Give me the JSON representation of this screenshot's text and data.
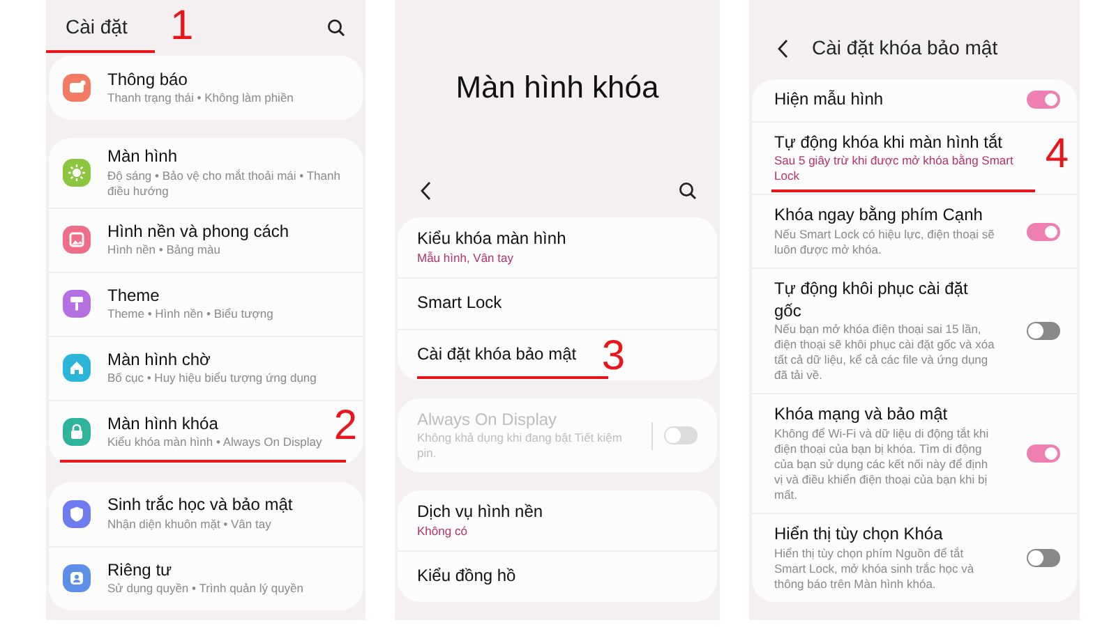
{
  "settings_screen": {
    "title": "Cài đặt",
    "title_marker": "1",
    "groups": [
      [
        {
          "title": "Thông báo",
          "subtitle": "Thanh trạng thái • Không làm phiền",
          "color": "#f37b64"
        }
      ],
      [
        {
          "title": "Màn hình",
          "subtitle": "Độ sáng • Bảo vệ cho mắt thoải mái • Thanh điều hướng",
          "color": "#8cc63f"
        },
        {
          "title": "Hình nền và phong cách",
          "subtitle": "Hình nền • Bảng màu",
          "color": "#ee6e8a"
        },
        {
          "title": "Theme",
          "subtitle": "Theme • Hình nền • Biểu tượng",
          "color": "#b56fe0"
        },
        {
          "title": "Màn hình chờ",
          "subtitle": "Bố cục • Huy hiệu biểu tượng ứng dụng",
          "color": "#2bb5d8"
        },
        {
          "title": "Màn hình khóa",
          "subtitle": "Kiểu khóa màn hình • Always On Display",
          "color": "#2fb39a",
          "marker": "2"
        }
      ],
      [
        {
          "title": "Sinh trắc học và bảo mật",
          "subtitle": "Nhận diện khuôn mặt • Vân tay",
          "color": "#6e7cf0"
        },
        {
          "title": "Riêng tư",
          "subtitle": "Sử dụng quyền • Trình quản lý quyền",
          "color": "#5d8fe8"
        }
      ]
    ]
  },
  "lock_screen": {
    "title": "Màn hình khóa",
    "groups": [
      [
        {
          "title": "Kiểu khóa màn hình",
          "subtitle": "Mẫu hình, Vân tay",
          "accent": true
        },
        {
          "title": "Smart Lock"
        },
        {
          "title": "Cài đặt khóa bảo mật",
          "marker": "3"
        }
      ],
      [
        {
          "title": "Always On Display",
          "subtitle": "Không khả dụng khi đang bật Tiết kiệm pin.",
          "accent": false,
          "disabled": true,
          "on": false
        }
      ],
      [
        {
          "title": "Dịch vụ hình nền",
          "subtitle": "Không có",
          "accent": true
        },
        {
          "title": "Kiểu đồng hồ"
        }
      ]
    ]
  },
  "secure_lock_settings": {
    "title": "Cài đặt khóa bảo mật",
    "items": [
      {
        "title": "Hiện mẫu hình",
        "on": true
      },
      {
        "title": "Tự động khóa khi màn hình tắt",
        "subtitle": "Sau 5 giây trừ khi được mở khóa bằng Smart Lock",
        "accent": true,
        "marker": "4"
      },
      {
        "title": "Khóa ngay bằng phím Cạnh",
        "subtitle": "Nếu Smart Lock có hiệu lực, điện thoại sẽ luôn được mở khóa.",
        "accent": false,
        "on": true
      },
      {
        "title": "Tự động khôi phục cài đặt gốc",
        "subtitle": "Nếu bạn mở khóa điện thoại sai 15 lần, điện thoại sẽ khôi phục cài đặt gốc và xóa tất cả dữ liệu, kể cả các file và ứng dụng đã tải về.",
        "accent": false,
        "on": false
      },
      {
        "title": "Khóa mạng và bảo mật",
        "subtitle": "Không để Wi-Fi và dữ liệu di động tắt khi điện thoại của bạn bị khóa. Tìm di động của bạn sử dụng các kết nối này để định vị và điều khiển điện thoại của bạn khi bị mất.",
        "accent": false,
        "on": true
      },
      {
        "title": "Hiển thị tùy chọn Khóa",
        "subtitle": "Hiển thị tùy chọn phím Nguồn để tắt Smart Lock, mở khóa sinh trắc học và thông báo trên Màn hình khóa.",
        "accent": false,
        "on": false
      }
    ]
  }
}
